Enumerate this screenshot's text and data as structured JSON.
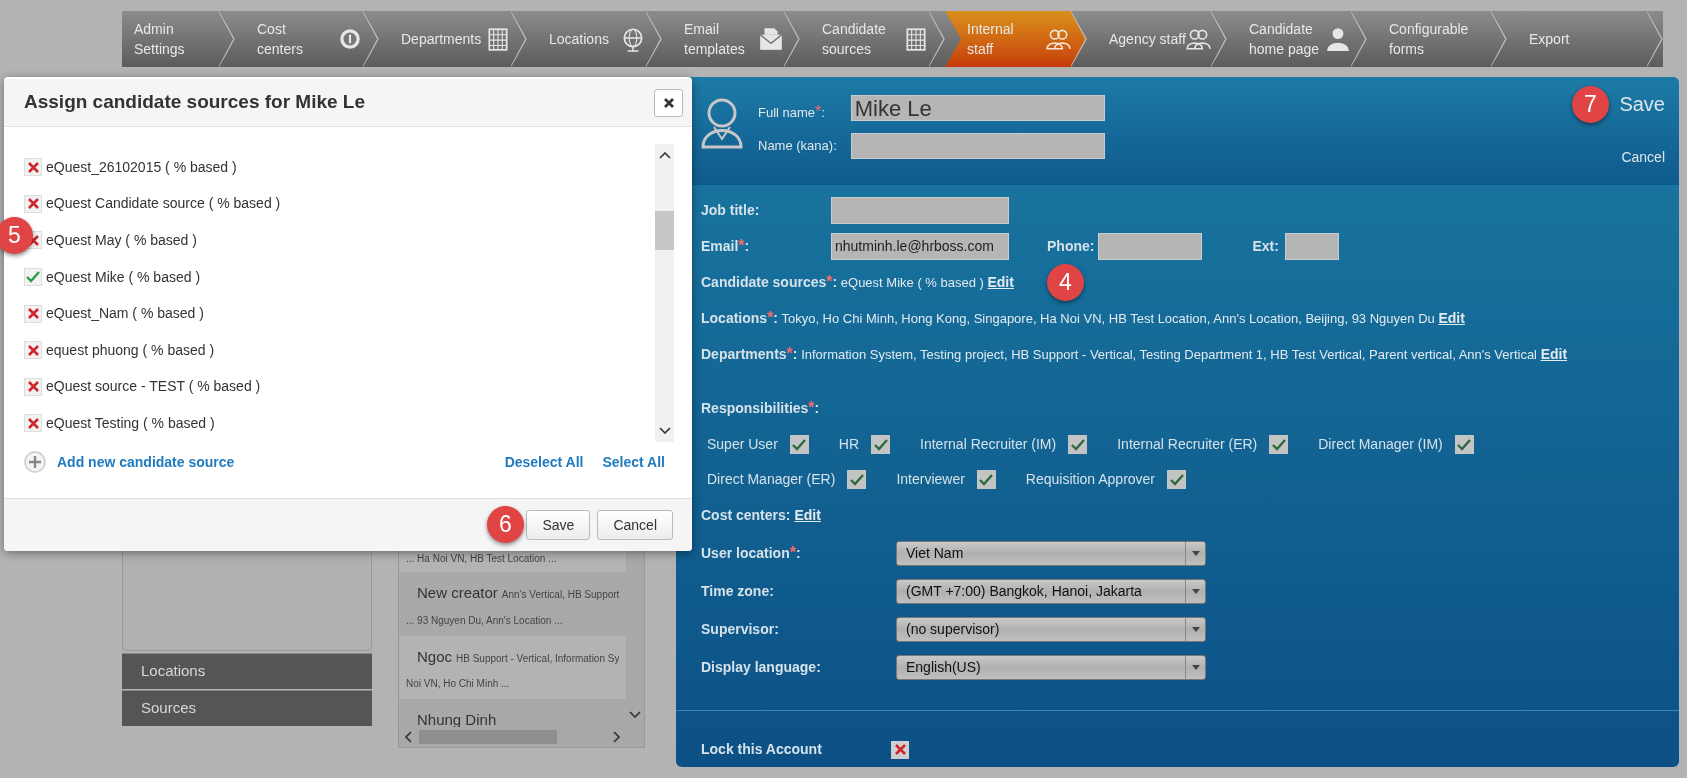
{
  "nav_tabs": [
    {
      "label": "Admin\nSettings",
      "selected": false
    },
    {
      "label": "Cost\ncenters",
      "selected": false
    },
    {
      "label": "Departments",
      "selected": false
    },
    {
      "label": "Locations",
      "selected": false
    },
    {
      "label": "Email\ntemplates",
      "selected": false
    },
    {
      "label": "Candidate\nsources",
      "selected": false
    },
    {
      "label": "Internal\nstaff",
      "selected": true
    },
    {
      "label": "Agency staff",
      "selected": false
    },
    {
      "label": "Candidate\nhome page",
      "selected": false
    },
    {
      "label": "Configurable\nforms",
      "selected": false
    },
    {
      "label": "Export",
      "selected": false
    }
  ],
  "sidebar": {
    "items": [
      "Locations",
      "Sources"
    ]
  },
  "staff_list": {
    "rows": [
      {
        "line_2": "...  Ha Noi VN, HB Test Location ..."
      },
      {
        "name": "New creator",
        "detail": "Ann's Vertical, HB Support",
        "line_2": "...  93 Nguyen Du, Ann's Location ..."
      },
      {
        "name": "Ngoc",
        "detail": "HB Support - Vertical, Information Sy",
        "line_2": "Noi VN, Ho Chi Minh ..."
      },
      {
        "name": "Nhung Dinh"
      }
    ]
  },
  "profile": {
    "full_name": {
      "label": "Full name",
      "required": "*",
      "colon": ":",
      "value": "Mike Le"
    },
    "kana": {
      "label": "Name (kana):"
    },
    "save": "Save",
    "cancel": "Cancel",
    "job_title": {
      "label": "Job title:"
    },
    "email": {
      "label": "Email",
      "required": "*",
      "colon": ":",
      "value": "nhutminh.le@hrboss.com"
    },
    "phone": {
      "label": "Phone:"
    },
    "ext": {
      "label": "Ext:"
    },
    "details": [
      {
        "label": "Candidate sources",
        "required": "*",
        "colon": ":",
        "text": "eQuest Mike ( % based )",
        "edit": "Edit"
      },
      {
        "label": "Locations",
        "required": "*",
        "colon": ":",
        "text": "Tokyo, Ho Chi Minh, Hong Kong, Singapore, Ha Noi VN, HB Test Location, Ann's Location, Beijing, 93 Nguyen Du",
        "edit": "Edit"
      },
      {
        "label": "Departments",
        "required": "*",
        "colon": ":",
        "text": "Information System, Testing project, HB Support - Vertical, Testing Department 1, HB Test Vertical, Parent vertical, Ann's Vertical",
        "edit": "Edit"
      }
    ],
    "responsibilities": {
      "label": "Responsibilities",
      "required": "*",
      "colon": ":",
      "items": [
        {
          "label": "Super User",
          "checked": true
        },
        {
          "label": "HR",
          "checked": true
        },
        {
          "label": "Internal Recruiter (IM)",
          "checked": true
        },
        {
          "label": "Internal Recruiter (ER)",
          "checked": true
        },
        {
          "label": "Direct Manager (IM)",
          "checked": true
        },
        {
          "label": "Direct Manager (ER)",
          "checked": true
        },
        {
          "label": "Interviewer",
          "checked": true
        },
        {
          "label": "Requisition Approver",
          "checked": true
        }
      ]
    },
    "cost_centers": {
      "label": "Cost centers:",
      "edit": "Edit"
    },
    "selects": [
      {
        "label": "User location",
        "required": "*",
        "colon": ":",
        "value": "Viet Nam"
      },
      {
        "label": "Time zone:",
        "value": "(GMT +7:00) Bangkok, Hanoi, Jakarta"
      },
      {
        "label": "Supervisor:",
        "value": "(no supervisor)"
      },
      {
        "label": "Display language:",
        "value": "English(US)"
      }
    ],
    "lock_account": {
      "label": "Lock this Account",
      "kind": "excluded"
    }
  },
  "dialog": {
    "title": "Assign candidate sources for Mike Le",
    "sources": [
      {
        "label": "eQuest_26102015 ( % based )",
        "kind": "excluded"
      },
      {
        "label": "eQuest Candidate source ( % based )",
        "kind": "excluded"
      },
      {
        "label": "eQuest May ( % based )",
        "kind": "excluded"
      },
      {
        "label": "eQuest Mike ( % based )",
        "kind": "included"
      },
      {
        "label": "eQuest_Nam ( % based )",
        "kind": "excluded"
      },
      {
        "label": "equest phuong ( % based )",
        "kind": "excluded"
      },
      {
        "label": "eQuest source - TEST ( % based )",
        "kind": "excluded"
      },
      {
        "label": "eQuest Testing ( % based )",
        "kind": "excluded"
      }
    ],
    "add_link": "Add new candidate source",
    "deselect_all": "Deselect All",
    "select_all": "Select All",
    "buttons": [
      "Save",
      "Cancel"
    ]
  },
  "annotations": [
    {
      "number": "7"
    },
    {
      "number": "4"
    },
    {
      "number": "5"
    },
    {
      "number": "6"
    }
  ]
}
